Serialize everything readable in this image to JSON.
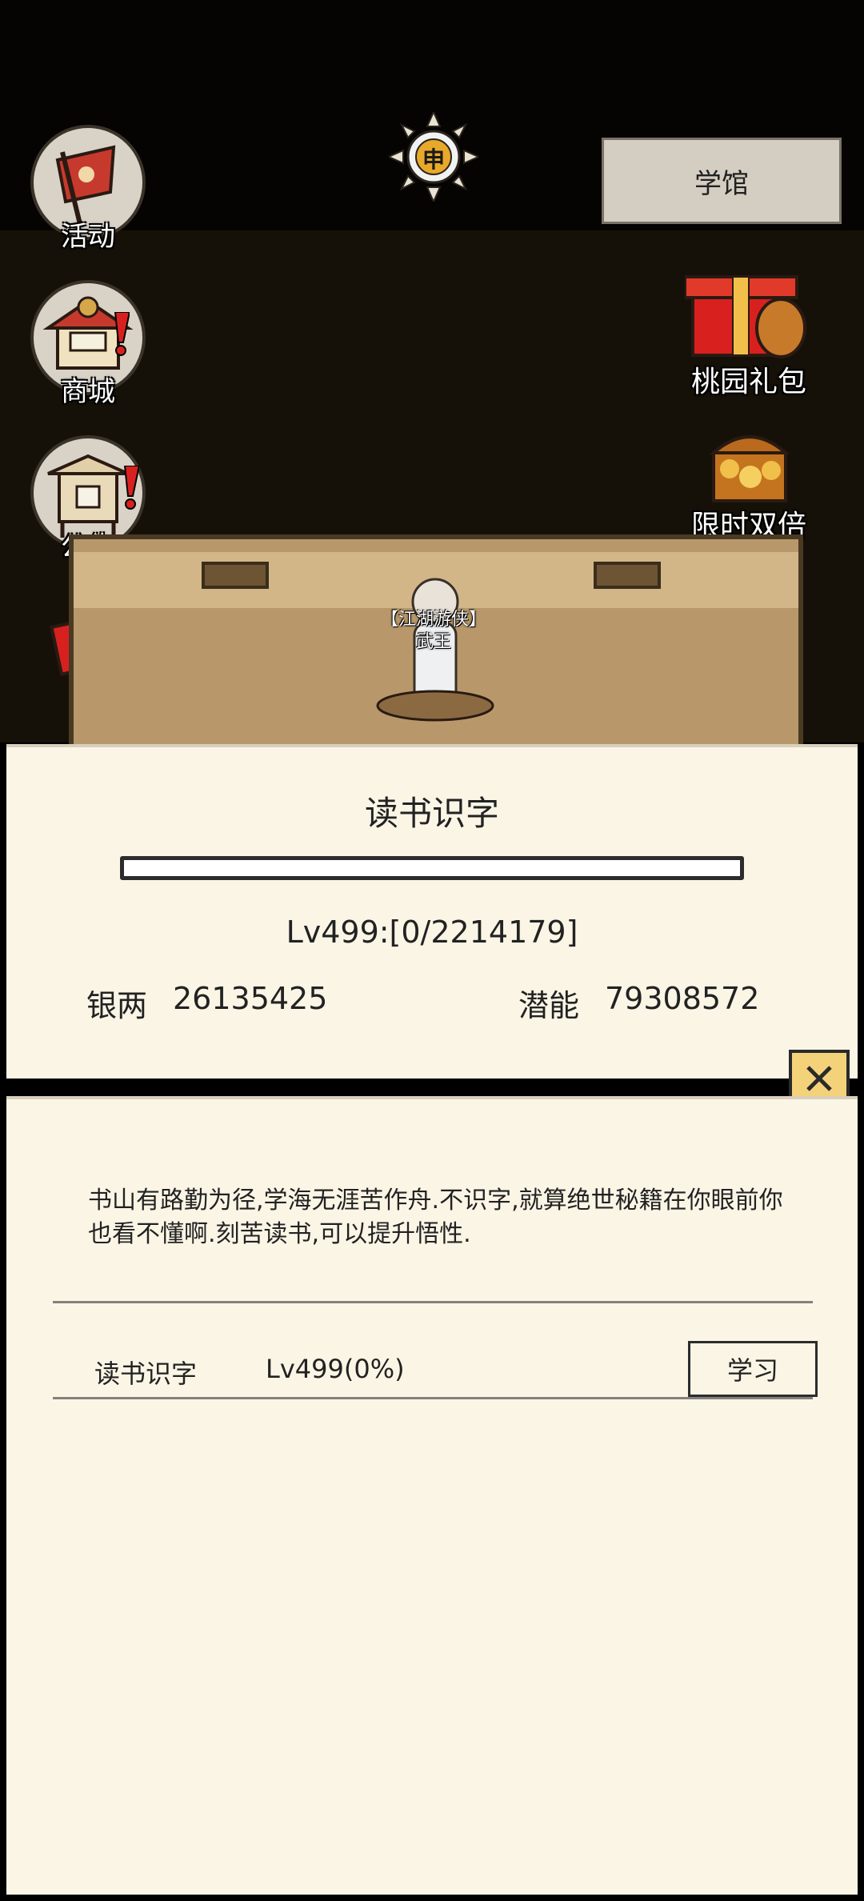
{
  "header": {
    "time_glyph": "申",
    "hall_button_label": "学馆"
  },
  "left_menu": [
    {
      "label": "活动",
      "icon": "flag-icon"
    },
    {
      "label": "商城",
      "icon": "shop-icon"
    },
    {
      "label": "公告",
      "icon": "notice-board-icon"
    },
    {
      "label": "",
      "icon": "gift-box-icon"
    }
  ],
  "right_menu": [
    {
      "label": "桃园礼包",
      "icon": "peach-garden-gift-icon"
    },
    {
      "label": "限时双倍",
      "icon": "treasure-chest-icon"
    }
  ],
  "character": {
    "title": "【江湖游侠】",
    "name": "武王"
  },
  "study_panel": {
    "title": "读书识字",
    "progress": 0,
    "level_text": "Lv499:[0/2214179]",
    "silver_label": "银两",
    "silver_value": "26135425",
    "potential_label": "潜能",
    "potential_value": "79308572"
  },
  "detail_panel": {
    "description": "书山有路勤为径,学海无涯苦作舟.不识字,就算绝世秘籍在你眼前你也看不懂啊.刻苦读书,可以提升悟性.",
    "skill_name": "读书识字",
    "skill_level": "Lv499(0%)",
    "study_button_label": "学习"
  },
  "colors": {
    "panel_bg": "#fbf5e6",
    "alert_red": "#d8211f",
    "close_badge": "#f3d27a"
  }
}
